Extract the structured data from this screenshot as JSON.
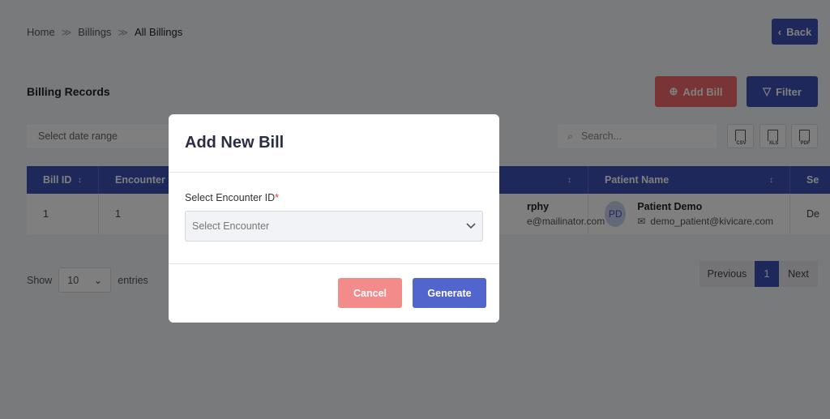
{
  "breadcrumb": {
    "home": "Home",
    "billings": "Billings",
    "current": "All Billings"
  },
  "header": {
    "back_label": "Back"
  },
  "section": {
    "title": "Billing Records",
    "add_bill_label": "Add Bill",
    "filter_label": "Filter"
  },
  "toolbar": {
    "date_range_placeholder": "Select date range",
    "search_placeholder": "Search...",
    "exports": [
      "CSV",
      "XLS",
      "PDF"
    ]
  },
  "table": {
    "columns": [
      "Bill ID",
      "Encounter I",
      "",
      "Patient Name",
      "Se"
    ],
    "rows": [
      {
        "bill_id": "1",
        "encounter_id": "1",
        "doctor_name_partial": "rphy",
        "doctor_email_partial": "e@mailinator.com",
        "patient_initials": "PD",
        "patient_name": "Patient Demo",
        "patient_email": "demo_patient@kivicare.com",
        "service_partial": "De"
      }
    ]
  },
  "pagination": {
    "show_label": "Show",
    "entries_value": "10",
    "entries_label": "entries",
    "previous": "Previous",
    "page": "1",
    "next": "Next"
  },
  "modal": {
    "title": "Add New Bill",
    "field_label": "Select Encounter ID",
    "required_mark": "*",
    "select_placeholder": "Select Encounter",
    "cancel_label": "Cancel",
    "generate_label": "Generate"
  },
  "colors": {
    "primary": "#3f51b5",
    "danger": "#f26b6b"
  }
}
